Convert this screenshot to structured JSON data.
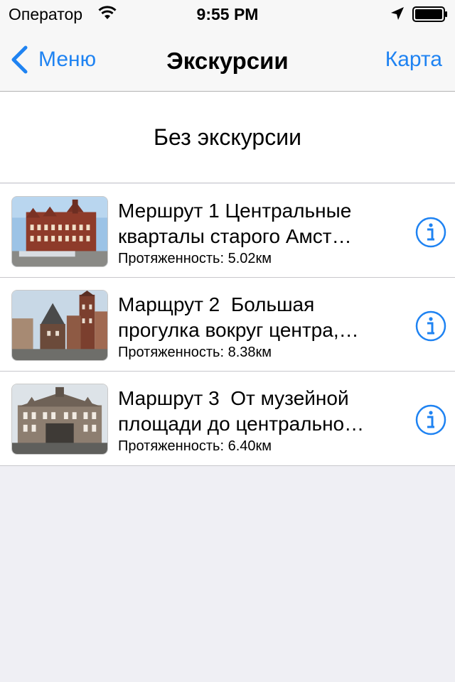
{
  "status_bar": {
    "carrier": "Оператор",
    "time": "9:55 PM"
  },
  "nav": {
    "back_label": "Меню",
    "title": "Экскурсии",
    "right_label": "Карта"
  },
  "no_tour_label": "Без экскурсии",
  "routes": [
    {
      "title": "Мершрут 1 Центральные кварталы старого Амст…",
      "length": "Протяженность: 5.02км"
    },
    {
      "title": "Марщрут 2  Большая прогулка вокруг центра,…",
      "length": "Протяженность: 8.38км"
    },
    {
      "title": "Маршрут 3  От музейной площади до центрально…",
      "length": "Протяженность: 6.40км"
    }
  ],
  "colors": {
    "accent": "#1f83f2",
    "background": "#efeff4"
  }
}
